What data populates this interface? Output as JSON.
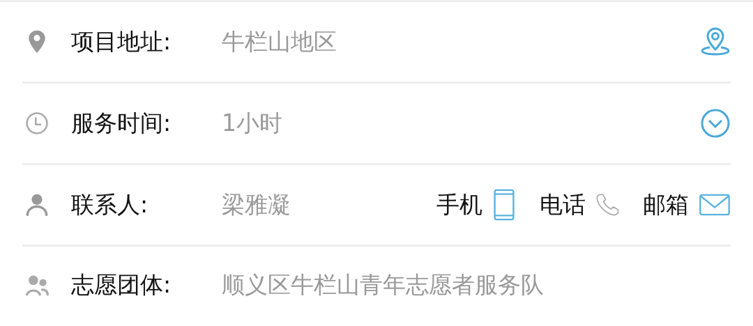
{
  "rows": [
    {
      "kind": "address",
      "label": "项目地址:",
      "value": "牛栏山地区"
    },
    {
      "kind": "time",
      "label": "服务时间:",
      "value": "1小时"
    },
    {
      "kind": "contact",
      "label": "联系人:",
      "value": "梁雅凝",
      "contacts": [
        {
          "kind": "mobile",
          "label": "手机"
        },
        {
          "kind": "phone",
          "label": "电话"
        },
        {
          "kind": "email",
          "label": "邮箱"
        }
      ]
    },
    {
      "kind": "group",
      "label": "志愿团体:",
      "value": "顺义区牛栏山青年志愿者服务队"
    }
  ]
}
